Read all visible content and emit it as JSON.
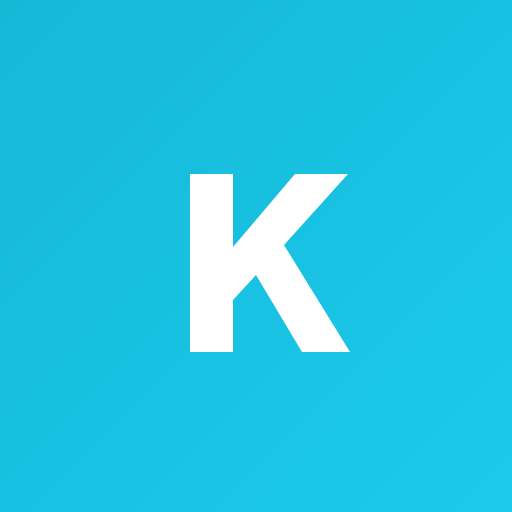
{
  "avatar": {
    "letter": "K",
    "background_start": "#16b8d8",
    "background_end": "#1bcaea",
    "letter_color": "#ffffff"
  }
}
